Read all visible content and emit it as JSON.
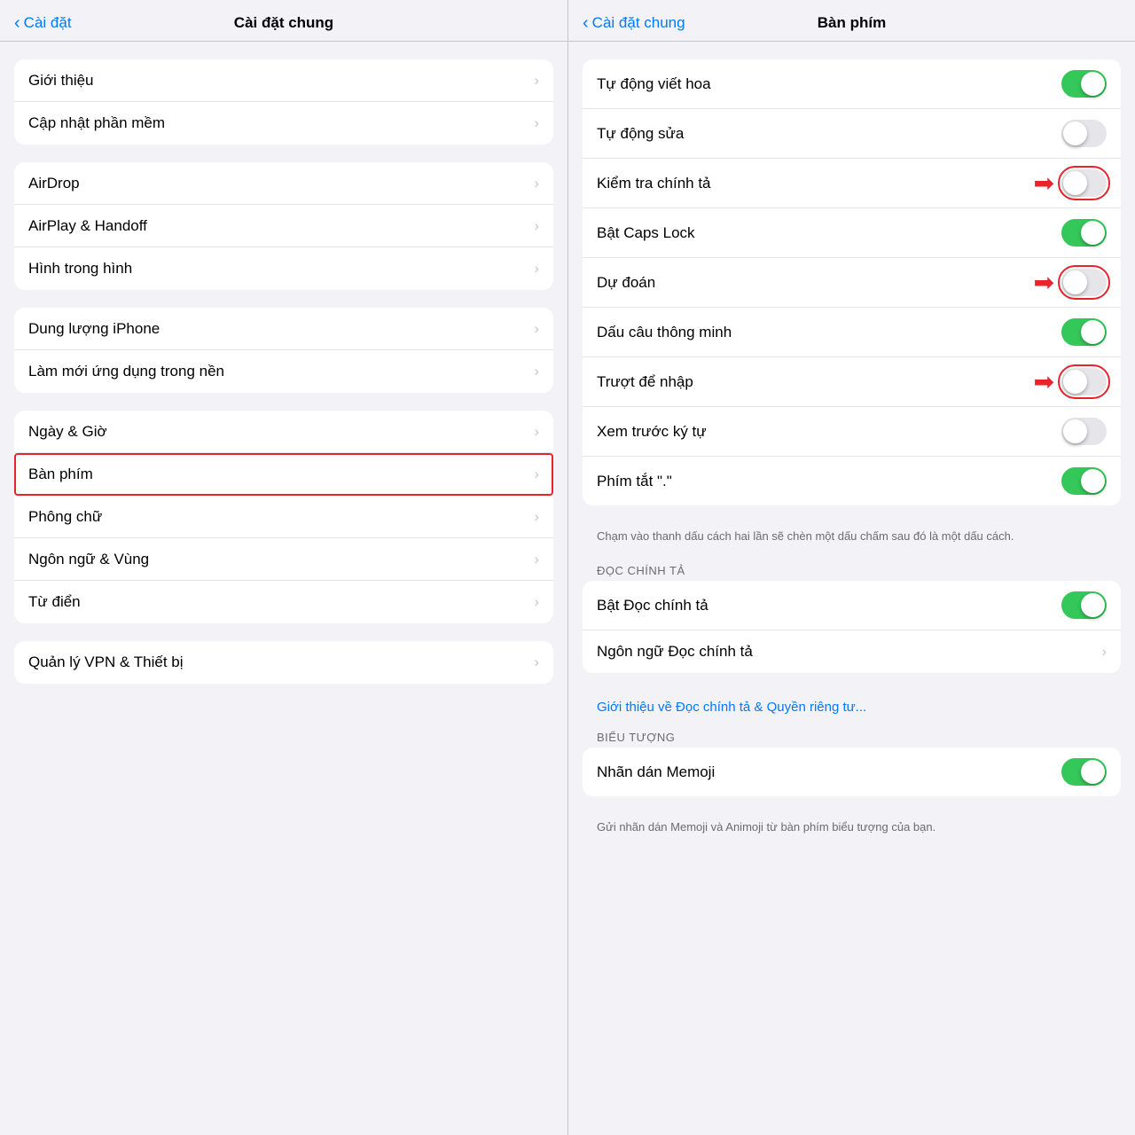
{
  "left": {
    "header": {
      "back_label": "Cài đặt",
      "title": "Cài đặt chung"
    },
    "groups": [
      {
        "id": "group1",
        "items": [
          {
            "id": "gioi-thieu",
            "label": "Giới thiệu",
            "has_chevron": true
          },
          {
            "id": "cap-nhat",
            "label": "Cập nhật phần mềm",
            "has_chevron": true
          }
        ]
      },
      {
        "id": "group2",
        "items": [
          {
            "id": "airdrop",
            "label": "AirDrop",
            "has_chevron": true
          },
          {
            "id": "airplay",
            "label": "AirPlay & Handoff",
            "has_chevron": true
          },
          {
            "id": "hinh-trong-hinh",
            "label": "Hình trong hình",
            "has_chevron": true
          }
        ]
      },
      {
        "id": "group3",
        "items": [
          {
            "id": "dung-luong",
            "label": "Dung lượng iPhone",
            "has_chevron": true
          },
          {
            "id": "lam-moi",
            "label": "Làm mới ứng dụng trong nền",
            "has_chevron": true
          }
        ]
      },
      {
        "id": "group4",
        "items": [
          {
            "id": "ngay-gio",
            "label": "Ngày & Giờ",
            "has_chevron": true
          },
          {
            "id": "ban-phim",
            "label": "Bàn phím",
            "has_chevron": true,
            "highlighted": true
          },
          {
            "id": "phong-chu",
            "label": "Phông chữ",
            "has_chevron": true
          },
          {
            "id": "ngon-ngu",
            "label": "Ngôn ngữ & Vùng",
            "has_chevron": true
          },
          {
            "id": "tu-dien",
            "label": "Từ điển",
            "has_chevron": true
          }
        ]
      },
      {
        "id": "group5",
        "items": [
          {
            "id": "quan-ly-vpn",
            "label": "Quản lý VPN & Thiết bị",
            "has_chevron": true
          }
        ]
      }
    ]
  },
  "right": {
    "header": {
      "back_label": "Cài đặt chung",
      "title": "Bàn phím"
    },
    "main_group": {
      "items": [
        {
          "id": "tu-dong-viet-hoa",
          "label": "Tự động viết hoa",
          "toggle": "on",
          "highlighted": false
        },
        {
          "id": "tu-dong-sua",
          "label": "Tự động sửa",
          "toggle": "off",
          "highlighted": false
        },
        {
          "id": "kiem-tra-chinh-ta",
          "label": "Kiểm tra chính tả",
          "toggle": "off",
          "highlighted": true
        },
        {
          "id": "bat-caps-lock",
          "label": "Bật Caps Lock",
          "toggle": "on",
          "highlighted": false
        },
        {
          "id": "du-doan",
          "label": "Dự đoán",
          "toggle": "off",
          "highlighted": true
        },
        {
          "id": "dau-cau-thong-minh",
          "label": "Dấu câu thông minh",
          "toggle": "on",
          "highlighted": false
        },
        {
          "id": "truot-de-nhap",
          "label": "Trượt để nhập",
          "toggle": "off",
          "highlighted": true
        },
        {
          "id": "xem-truoc-ky-tu",
          "label": "Xem trước ký tự",
          "toggle": "off",
          "highlighted": false
        },
        {
          "id": "phim-tat",
          "label": "Phím tắt \".\"",
          "toggle": "on",
          "highlighted": false
        }
      ],
      "footer": "Chạm vào thanh dấu cách hai lần sẽ chèn một dấu chấm sau đó là một dấu cách."
    },
    "doc_section": {
      "header": "ĐỌC CHÍNH TẢ",
      "items": [
        {
          "id": "bat-doc-chinh-ta",
          "label": "Bật Đọc chính tả",
          "toggle": "on"
        },
        {
          "id": "ngon-ngu-doc",
          "label": "Ngôn ngữ Đọc chính tả",
          "has_chevron": true
        }
      ],
      "link": "Giới thiệu về Đọc chính tả & Quyền riêng tư..."
    },
    "bieu_tuong_section": {
      "header": "BIỂU TƯỢNG",
      "items": [
        {
          "id": "nhan-dan-memoji",
          "label": "Nhãn dán Memoji",
          "toggle": "on"
        }
      ],
      "footer": "Gửi nhãn dán Memoji và Animoji từ bàn phím biểu tượng của bạn."
    }
  },
  "icons": {
    "chevron": "›",
    "chevron_back": "‹",
    "arrow_right": "➡"
  },
  "colors": {
    "accent": "#007aff",
    "toggle_on": "#34c759",
    "toggle_off": "#e5e5ea",
    "highlight_red": "#e8232a",
    "separator": "#e5e5ea",
    "text_primary": "#000000",
    "text_secondary": "#6c6c70",
    "background": "#f2f2f7",
    "card_bg": "#ffffff"
  }
}
